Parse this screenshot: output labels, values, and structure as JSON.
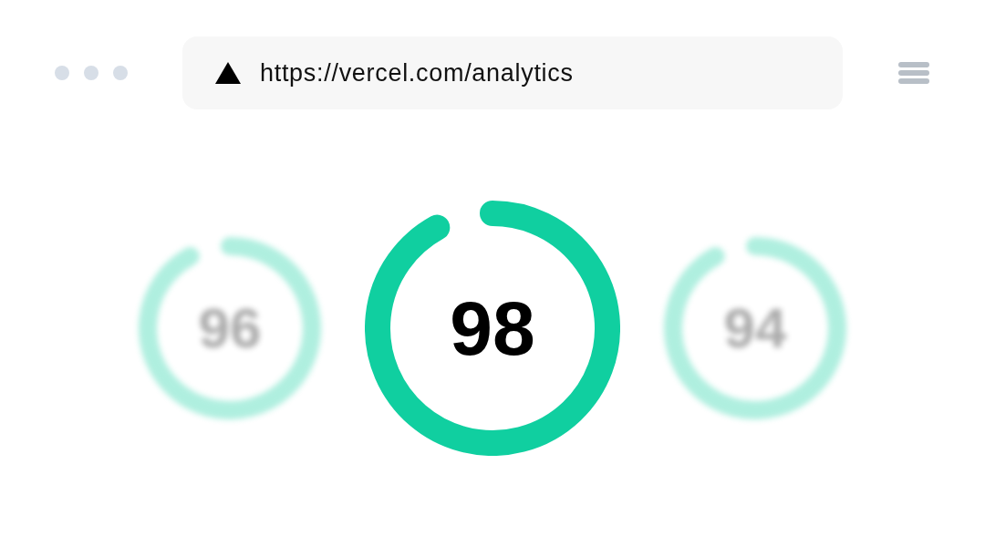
{
  "address_bar": {
    "url": "https://vercel.com/analytics"
  },
  "gauges": [
    {
      "score": "96",
      "focused": false
    },
    {
      "score": "98",
      "focused": true
    },
    {
      "score": "94",
      "focused": false
    }
  ]
}
